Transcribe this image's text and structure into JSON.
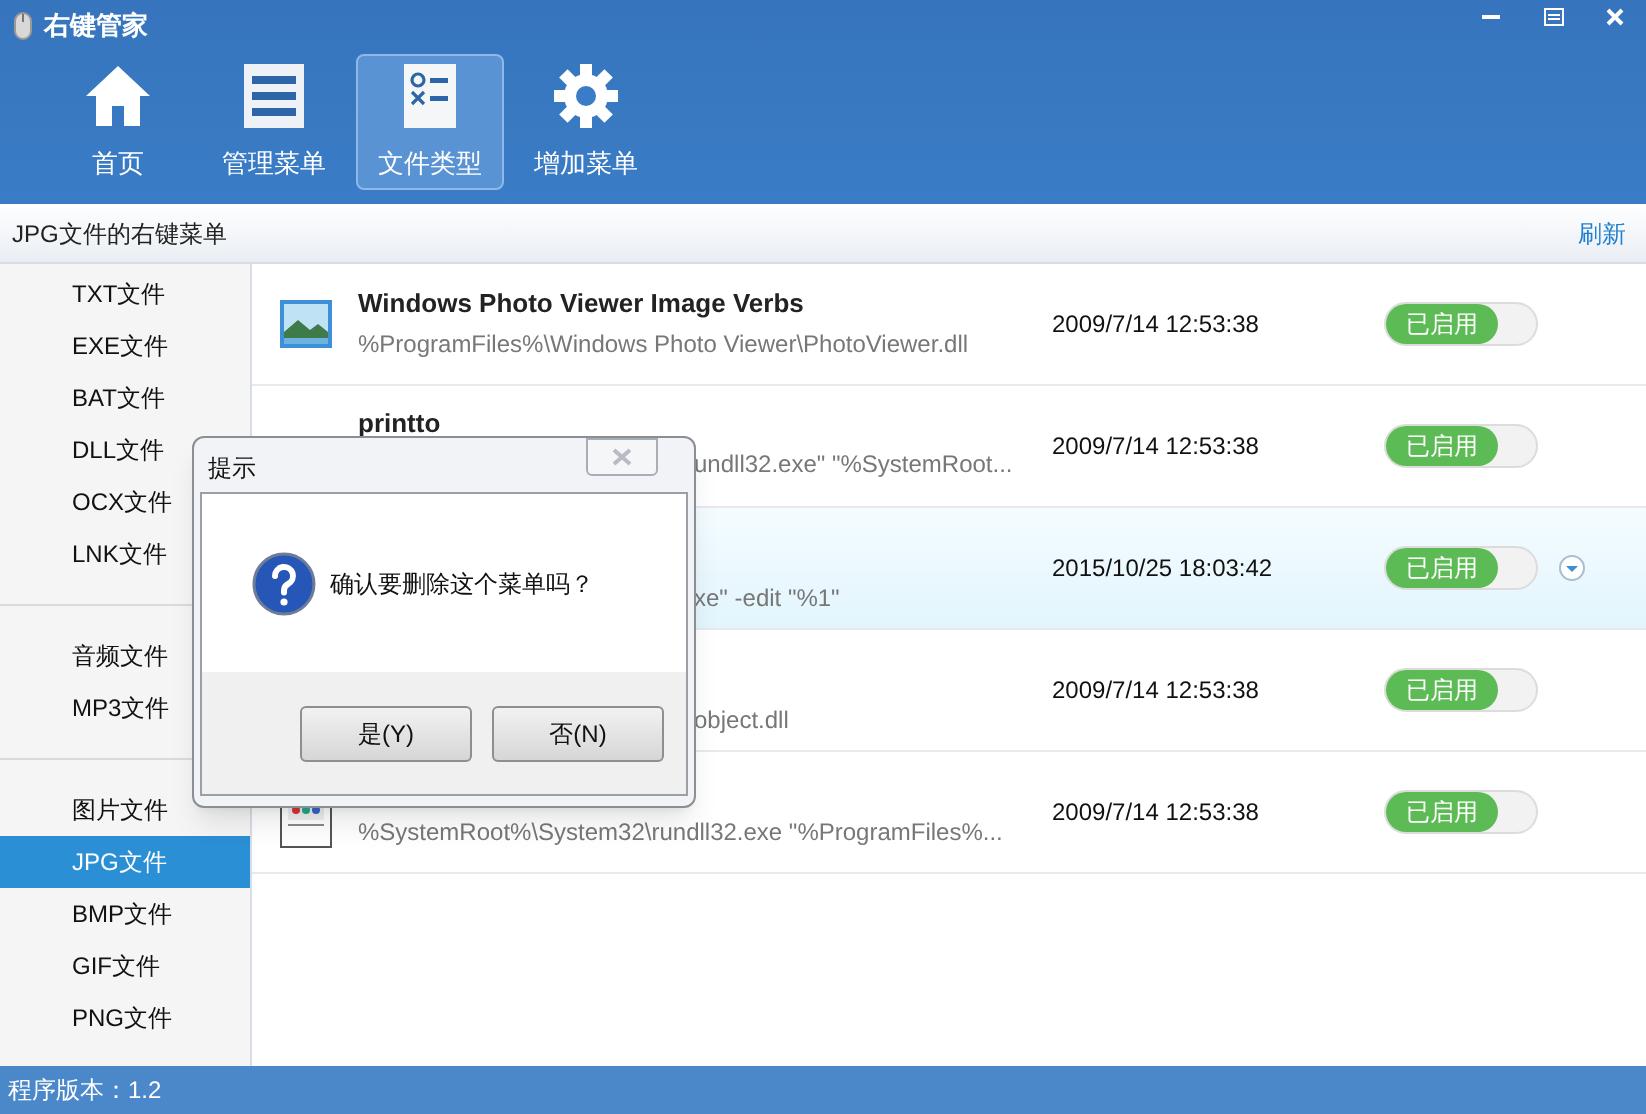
{
  "window": {
    "title": "右键管家"
  },
  "toolbar": [
    {
      "label": "首页",
      "kind": "home",
      "selected": false
    },
    {
      "label": "管理菜单",
      "kind": "list",
      "selected": false
    },
    {
      "label": "文件类型",
      "kind": "form",
      "selected": true
    },
    {
      "label": "增加菜单",
      "kind": "gear",
      "selected": false
    }
  ],
  "header": {
    "title": "JPG文件的右键菜单",
    "refresh": "刷新"
  },
  "sidebar": [
    [
      {
        "label": "TXT文件",
        "selected": false
      },
      {
        "label": "EXE文件",
        "selected": false
      },
      {
        "label": "BAT文件",
        "selected": false
      },
      {
        "label": "DLL文件",
        "selected": false
      },
      {
        "label": "OCX文件",
        "selected": false
      },
      {
        "label": "LNK文件",
        "selected": false
      }
    ],
    [
      {
        "label": "音频文件",
        "selected": false
      },
      {
        "label": "MP3文件",
        "selected": false
      }
    ],
    [
      {
        "label": "图片文件",
        "selected": false
      },
      {
        "label": "JPG文件",
        "selected": true
      },
      {
        "label": "BMP文件",
        "selected": false
      },
      {
        "label": "GIF文件",
        "selected": false
      },
      {
        "label": "PNG文件",
        "selected": false
      }
    ]
  ],
  "rows": [
    {
      "kind": "full",
      "icon": {
        "kind": "photo"
      },
      "title": "Windows Photo Viewer Image Verbs",
      "path": "%ProgramFiles%\\Windows Photo Viewer\\PhotoViewer.dll",
      "date": "2009/7/14 12:53:38",
      "status": "已启用",
      "enabled": true,
      "highlighted": false
    },
    {
      "kind": "clipped",
      "title": "printto",
      "path": "undll32.exe\" \"%SystemRoot...",
      "date": "2009/7/14 12:53:38",
      "status": "已启用",
      "enabled": true,
      "highlighted": false
    },
    {
      "kind": "clipped",
      "path": "xe\" -edit \"%1\"",
      "date": "2015/10/25 18:03:42",
      "status": "已启用",
      "enabled": true,
      "highlighted": true
    },
    {
      "kind": "clipped",
      "path": "object.dll",
      "date": "2009/7/14 12:53:38",
      "status": "已启用",
      "enabled": true,
      "highlighted": false
    },
    {
      "kind": "full",
      "icon": {
        "kind": "app"
      },
      "path": "%SystemRoot%\\System32\\rundll32.exe \"%ProgramFiles%...",
      "date": "2009/7/14 12:53:38",
      "status": "已启用",
      "enabled": true,
      "highlighted": false
    }
  ],
  "dialog": {
    "title": "提示",
    "message": "确认要删除这个菜单吗？",
    "buttons": [
      "是(Y)",
      "否(N)"
    ]
  },
  "status_bar": "程序版本：1.2"
}
